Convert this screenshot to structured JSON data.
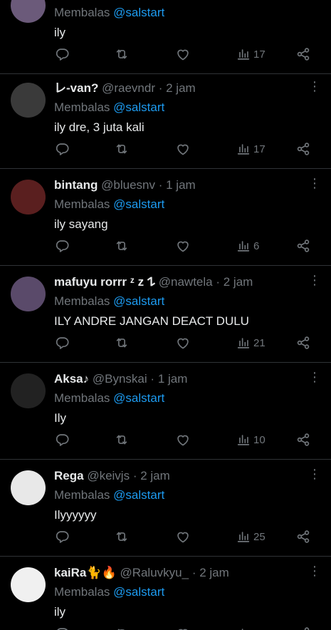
{
  "labels": {
    "replying_to": "Membalas",
    "dot": "·"
  },
  "colors": {
    "background": "#000000",
    "text": "#e7e9ea",
    "muted": "#71767b",
    "link": "#1d9bf0",
    "divider": "#2f3336"
  },
  "icons": [
    "comment-icon",
    "retweet-icon",
    "heart-icon",
    "views-icon",
    "share-icon",
    "more-icon"
  ],
  "replies": [
    {
      "name": "",
      "handle": "",
      "time": "",
      "mention": "@salstart",
      "text": "ily",
      "views": "17",
      "avatar_color": "#6b5a7a"
    },
    {
      "name": "レ-van?",
      "handle": "@raevndr",
      "time": "2 jam",
      "mention": "@salstart",
      "text": "ily dre, 3 juta kali",
      "views": "17",
      "avatar_color": "#3a3a3a"
    },
    {
      "name": "bintang",
      "handle": "@bluesnv",
      "time": "1 jam",
      "mention": "@salstart",
      "text": "ily sayang",
      "views": "6",
      "avatar_color": "#5a1f1f"
    },
    {
      "name": "mafuyu rorrr ᶻ z 𐰁",
      "handle": "@nawtela",
      "time": "2 jam",
      "mention": "@salstart",
      "text": "ILY ANDRE JANGAN DEACT DULU",
      "views": "21",
      "avatar_color": "#5a4a6a"
    },
    {
      "name": "Aksa♪",
      "handle": "@Bynskai",
      "time": "1 jam",
      "mention": "@salstart",
      "text": "Ily",
      "views": "10",
      "avatar_color": "#222222"
    },
    {
      "name": "Rega",
      "handle": "@keivjs",
      "time": "2 jam",
      "mention": "@salstart",
      "text": "Ilyyyyyy",
      "views": "25",
      "avatar_color": "#e8e8e8"
    },
    {
      "name": "kaiRa🐈🔥",
      "handle": "@Raluvkyu_",
      "time": "2 jam",
      "mention": "@salstart",
      "text": "ily",
      "views": "",
      "avatar_color": "#f0f0f0"
    }
  ]
}
